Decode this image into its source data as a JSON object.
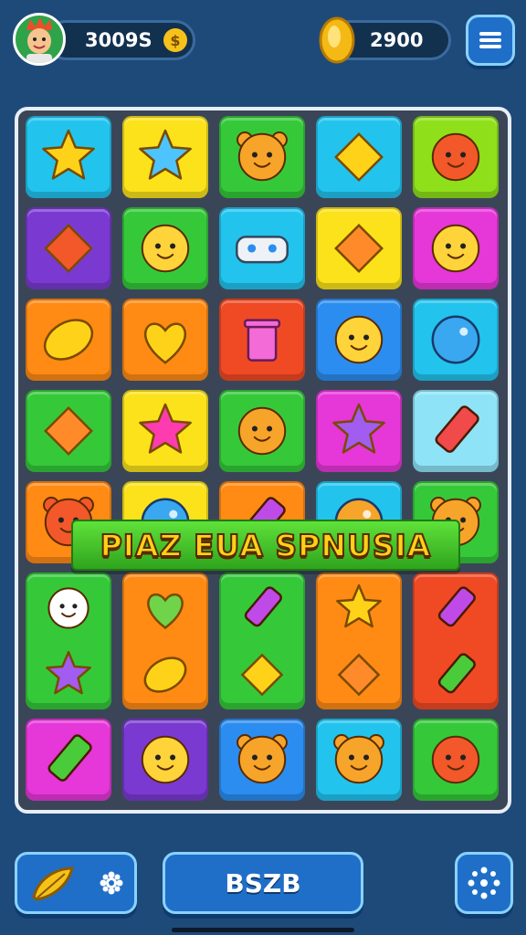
{
  "hud": {
    "score": "3009S",
    "score_badge": "$",
    "coins": "2900"
  },
  "banner": {
    "text": "PIAZ EUA SPNUSIA"
  },
  "bottom": {
    "center_label": "BSZB"
  },
  "colors": {
    "background": "#1e4a7a",
    "banner": "#3fbf2a",
    "banner_text": "#ffd11a"
  },
  "board": {
    "columns": 5,
    "rows": [
      [
        {
          "bg": "cyan",
          "icon": "yellow-star-icon"
        },
        {
          "bg": "yellow",
          "icon": "blue-star-icon"
        },
        {
          "bg": "green",
          "icon": "orange-bear-face-icon"
        },
        {
          "bg": "cyan",
          "icon": "yellow-diamond-creature-icon"
        },
        {
          "bg": "lime",
          "icon": "red-octopus-icon"
        }
      ],
      [
        {
          "bg": "purple",
          "icon": "red-shell-icon"
        },
        {
          "bg": "green",
          "icon": "yellow-sun-face-icon"
        },
        {
          "bg": "cyan",
          "icon": "white-robot-car-icon"
        },
        {
          "bg": "yellow",
          "icon": "orange-flower-icon"
        },
        {
          "bg": "magenta",
          "icon": "yellow-lemon-face-icon"
        }
      ],
      [
        {
          "bg": "orange",
          "icon": "yellow-lemon-icon"
        },
        {
          "bg": "orange",
          "icon": "yellow-heart-icon"
        },
        {
          "bg": "red",
          "icon": "pink-trash-can-icon"
        },
        {
          "bg": "blue",
          "icon": "yellow-sun-face-icon"
        },
        {
          "bg": "cyan",
          "icon": "blue-bubble-icon"
        }
      ],
      [
        {
          "bg": "green",
          "icon": "orange-lollipop-icon"
        },
        {
          "bg": "yellow",
          "icon": "pink-star-icon"
        },
        {
          "bg": "green",
          "icon": "orange-cookie-face-icon"
        },
        {
          "bg": "magenta",
          "icon": "purple-star-icon"
        },
        {
          "bg": "lightblue",
          "icon": "red-crayon-icon"
        }
      ],
      [
        {
          "bg": "orange",
          "icon": "red-bear-face-icon"
        },
        {
          "bg": "yellow",
          "icon": "blue-blob-icon"
        },
        {
          "bg": "orange",
          "icon": "orange-candy-icon"
        },
        {
          "bg": "cyan",
          "icon": "orange-blob-icon"
        },
        {
          "bg": "green",
          "icon": "orange-bear-face-icon"
        }
      ],
      [
        {
          "bg": "green",
          "icon": "white-ghost-and-purple-star-icon"
        },
        {
          "bg": "orange",
          "icon": "green-heart-and-yellow-leaf-icon"
        },
        {
          "bg": "green",
          "icon": "purple-candy-and-blue-lollipop-icon"
        },
        {
          "bg": "orange",
          "icon": "yellow-star-and-orange-fish-icon"
        },
        {
          "bg": "red",
          "icon": "purple-eraser-and-green-crayon-icon"
        }
      ],
      [
        {
          "bg": "magenta",
          "icon": "green-pencil-icon"
        },
        {
          "bg": "purple",
          "icon": "yellow-hat-face-icon"
        },
        {
          "bg": "blue",
          "icon": "orange-bear-face-icon"
        },
        {
          "bg": "cyan",
          "icon": "orange-bear-face-icon"
        },
        {
          "bg": "green",
          "icon": "red-balloon-face-icon"
        }
      ]
    ]
  }
}
